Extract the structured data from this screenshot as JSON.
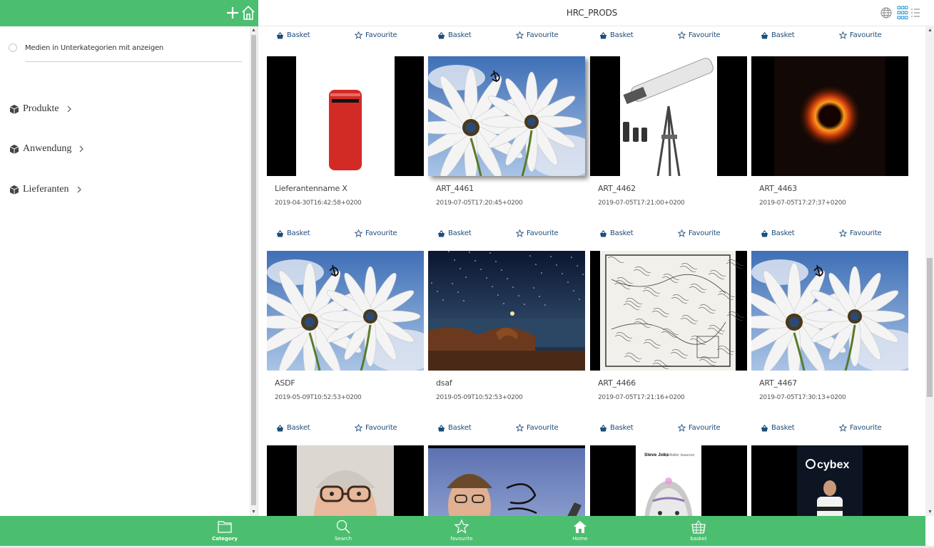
{
  "header": {
    "title": "HRC_PRODS"
  },
  "sidebar": {
    "subcategory_toggle": "Medien in Unterkategorien mit anzeigen",
    "categories": [
      {
        "label": "Produkte"
      },
      {
        "label": "Anwendung"
      },
      {
        "label": "Lieferanten"
      }
    ]
  },
  "actions": {
    "basket": "Basket",
    "favourite": "Favourite"
  },
  "items": [
    {
      "name": "Lieferantenname X",
      "date": "2019-04-30T16:42:58+0200",
      "image": "red-phone"
    },
    {
      "name": "ART_4461",
      "date": "2019-07-05T17:20:45+0200",
      "image": "daisies"
    },
    {
      "name": "ART_4462",
      "date": "2019-07-05T17:21:00+0200",
      "image": "telescope"
    },
    {
      "name": "ART_4463",
      "date": "2019-07-05T17:27:37+0200",
      "image": "black-hole"
    },
    {
      "name": "ASDF",
      "date": "2019-05-09T10:52:53+0200",
      "image": "daisies"
    },
    {
      "name": "dsaf",
      "date": "2019-05-09T10:52:53+0200",
      "image": "night-coast"
    },
    {
      "name": "ART_4466",
      "date": "2019-07-05T17:21:16+0200",
      "image": "old-map"
    },
    {
      "name": "ART_4467",
      "date": "2019-07-05T17:30:13+0200",
      "image": "daisies"
    },
    {
      "name": "",
      "date": "",
      "image": "portrait-man"
    },
    {
      "name": "",
      "date": "",
      "image": "portrait-man-2"
    },
    {
      "name": "",
      "date": "",
      "image": "book-cover",
      "caption": "Steve Jobs",
      "caption_by": "by Walter Isaacson"
    },
    {
      "name": "",
      "date": "",
      "image": "cybex-stage",
      "caption": "cybex"
    }
  ],
  "bottom_nav": [
    {
      "label": "Category",
      "icon": "folder-icon",
      "active": true
    },
    {
      "label": "Search",
      "icon": "search-icon",
      "active": false
    },
    {
      "label": "favourite",
      "icon": "star-icon",
      "active": false
    },
    {
      "label": "Home",
      "icon": "home-icon",
      "active": false
    },
    {
      "label": "basket",
      "icon": "basket-icon",
      "active": false
    }
  ],
  "colors": {
    "accent": "#4cbe70",
    "link": "#1f4d7a"
  }
}
